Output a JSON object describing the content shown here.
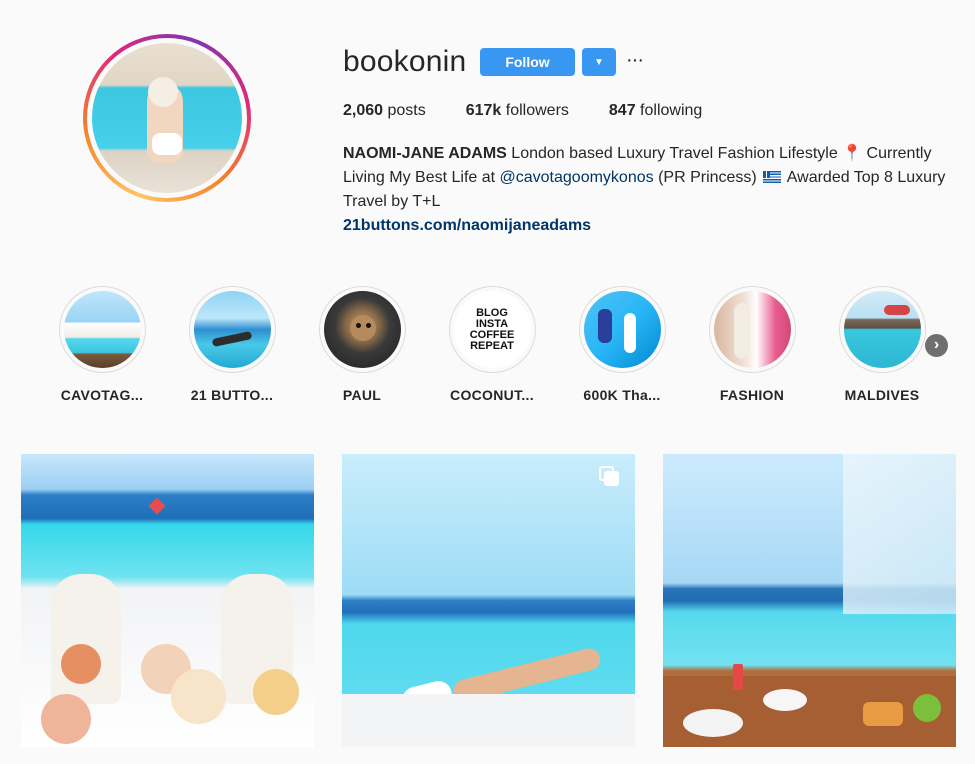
{
  "profile": {
    "username": "bookonin",
    "follow_label": "Follow",
    "dropdown_icon": "caret-down-icon",
    "more_label": "···",
    "stats": {
      "posts_count": "2,060",
      "posts_label": " posts",
      "followers_count": "617k",
      "followers_label": " followers",
      "following_count": "847",
      "following_label": " following"
    },
    "bio": {
      "name": "NAOMI-JANE ADAMS",
      "text_1": " London based Luxury Travel Fashion Lifestyle ",
      "pin_glyph": "📍",
      "text_2": " Currently Living My Best Life at ",
      "mention": "@cavotagoomykonos",
      "text_3": " (PR Princess) ",
      "text_4": " Awarded Top 8 Luxury Travel by T+L",
      "website": "21buttons.com/naomijaneadams"
    }
  },
  "highlights": [
    {
      "label": "CAVOTAG..."
    },
    {
      "label": "21 BUTTO..."
    },
    {
      "label": "PAUL"
    },
    {
      "label": "COCONUT..."
    },
    {
      "label": "600K Tha..."
    },
    {
      "label": "FASHION"
    },
    {
      "label": "MALDIVES"
    }
  ],
  "highlight_coconut_text": [
    "BLOG",
    "INSTA",
    "COFFEE",
    "REPEAT"
  ],
  "next_arrow": "›",
  "colors": {
    "accent": "#3897f0",
    "link": "#003569",
    "background": "#fafafa"
  }
}
